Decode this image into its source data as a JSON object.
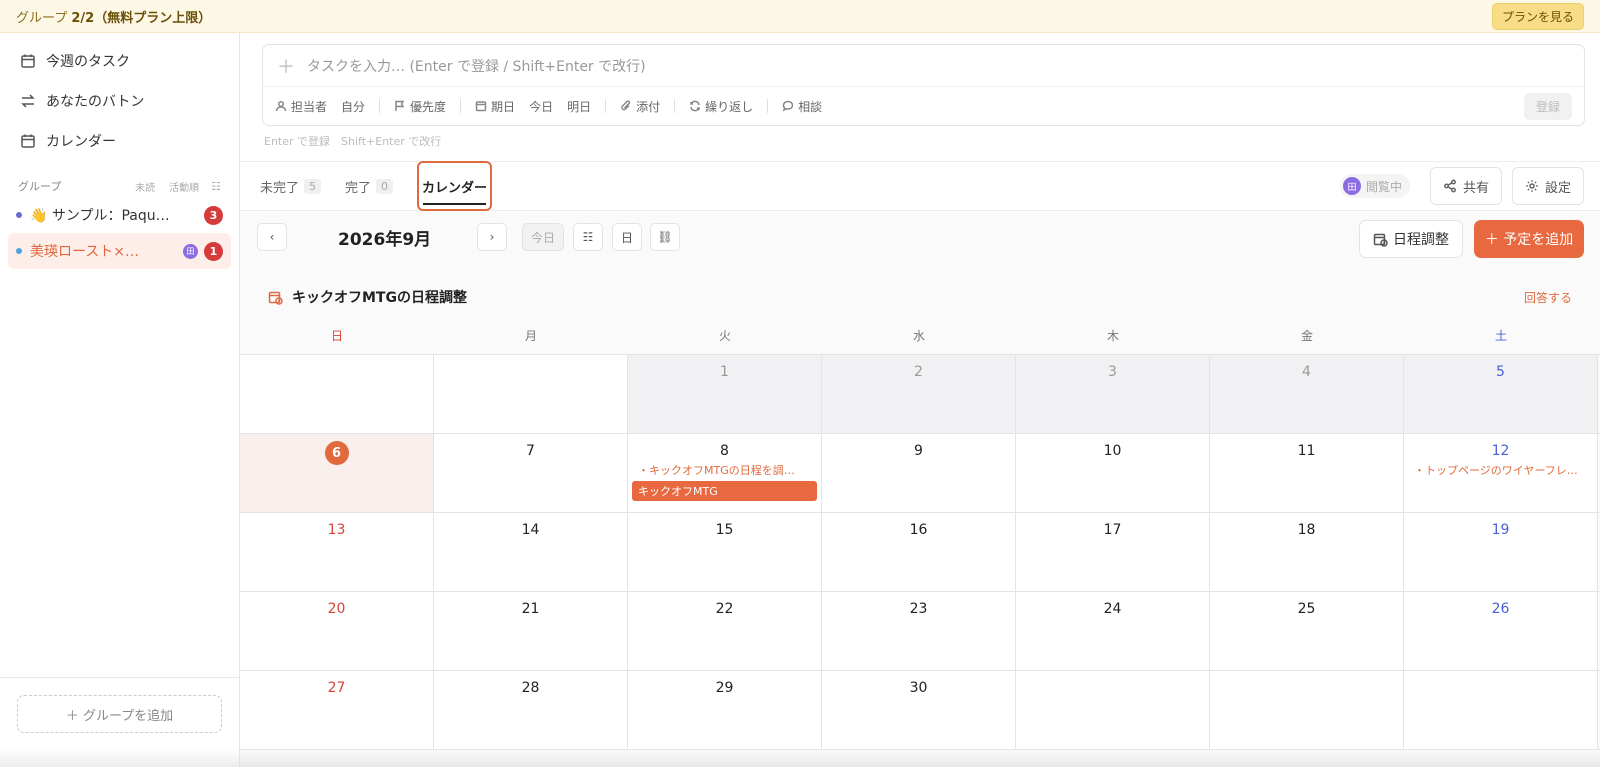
{
  "banner": {
    "prefix": "グループ ",
    "count": "2/2",
    "suffix": "（無料プラン上限）",
    "button": "プランを見る"
  },
  "sidebar": {
    "nav": [
      {
        "label": "今週のタスク",
        "icon": "calendar-icon"
      },
      {
        "label": "あなたのバトン",
        "icon": "swap-icon"
      },
      {
        "label": "カレンダー",
        "icon": "calendar-icon"
      }
    ],
    "group_header": {
      "title": "グループ",
      "opt1": "未読",
      "opt2": "活動順"
    },
    "groups": [
      {
        "label": "👋 サンプル：Paqu…",
        "dot_color": "#6b6bd6",
        "badge": "3"
      },
      {
        "label": "美瑛ロースト×…",
        "dot_color": "#4fa0e0",
        "badge": "1",
        "avatar": "田"
      }
    ],
    "add_group": "＋ グループを追加"
  },
  "task_input": {
    "placeholder": "タスクを入力… (Enter で登録 / Shift+Enter で改行)",
    "tools": {
      "assignee": "担当者",
      "self": "自分",
      "priority": "優先度",
      "due": "期日",
      "today": "今日",
      "tomorrow": "明日",
      "attach": "添付",
      "repeat": "繰り返し",
      "consult": "相談"
    },
    "register": "登録",
    "hint": "Enter で登録　Shift+Enter で改行"
  },
  "tabs": {
    "incomplete": {
      "label": "未完了",
      "count": "5"
    },
    "complete": {
      "label": "完了",
      "count": "0"
    },
    "calendar": {
      "label": "カレンダー"
    },
    "viewing": {
      "avatar": "田",
      "label": "閲覧中"
    },
    "share": "共有",
    "settings": "設定"
  },
  "calendar": {
    "month": "2026年9月",
    "today_btn": "今日",
    "day_btn": "日",
    "schedule_btn": "日程調整",
    "add_event": "＋ 予定を追加",
    "notice": {
      "title": "キックオフMTGの日程調整",
      "link": "回答する"
    },
    "dow": [
      "日",
      "月",
      "火",
      "水",
      "木",
      "金",
      "土"
    ],
    "weeks": [
      [
        {
          "num": "",
          "outside": false
        },
        {
          "num": "",
          "outside": false
        },
        {
          "num": "1",
          "outside": true
        },
        {
          "num": "2",
          "outside": true
        },
        {
          "num": "3",
          "outside": true
        },
        {
          "num": "4",
          "outside": true
        },
        {
          "num": "5",
          "outside": true
        }
      ],
      [
        {
          "num": "6",
          "today": true
        },
        {
          "num": "7"
        },
        {
          "num": "8",
          "dot_event": "・キックオフMTGの日程を調…",
          "bar_event": "キックオフMTG"
        },
        {
          "num": "9"
        },
        {
          "num": "10"
        },
        {
          "num": "11"
        },
        {
          "num": "12",
          "dot_event": "・トップページのワイヤーフレ…"
        }
      ],
      [
        {
          "num": "13"
        },
        {
          "num": "14"
        },
        {
          "num": "15"
        },
        {
          "num": "16"
        },
        {
          "num": "17"
        },
        {
          "num": "18"
        },
        {
          "num": "19"
        }
      ],
      [
        {
          "num": "20"
        },
        {
          "num": "21"
        },
        {
          "num": "22"
        },
        {
          "num": "23"
        },
        {
          "num": "24"
        },
        {
          "num": "25"
        },
        {
          "num": "26"
        }
      ],
      [
        {
          "num": "27"
        },
        {
          "num": "28"
        },
        {
          "num": "29"
        },
        {
          "num": "30"
        },
        {
          "num": ""
        },
        {
          "num": ""
        },
        {
          "num": ""
        }
      ]
    ]
  },
  "colors": {
    "accent": "#e8693f",
    "sunday": "#d6453a",
    "saturday": "#4a5fd6"
  }
}
